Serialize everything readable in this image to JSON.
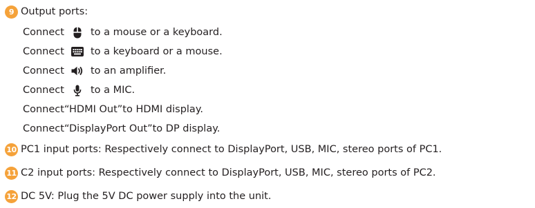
{
  "accent_color": "#f5a23a",
  "section9": {
    "badge": "9",
    "title": "Output ports:",
    "lines": [
      {
        "prefix": "Connect",
        "icon": "mouse-icon",
        "suffix": "to a mouse or a keyboard."
      },
      {
        "prefix": "Connect",
        "icon": "keyboard-icon",
        "suffix": "to a keyboard or a mouse."
      },
      {
        "prefix": "Connect",
        "icon": "speaker-icon",
        "suffix": "to an amplifier."
      },
      {
        "prefix": "Connect",
        "icon": "microphone-icon",
        "suffix": "to a MIC."
      }
    ],
    "hdmi_line": "Connect“HDMI Out”to HDMI display.",
    "dp_line": "Connect“DisplayPort Out”to DP display."
  },
  "items": [
    {
      "badge": "10",
      "text": "PC1 input ports: Respectively connect to DisplayPort, USB, MIC, stereo ports of PC1."
    },
    {
      "badge": "11",
      "text": "C2 input ports: Respectively connect to DisplayPort, USB, MIC, stereo ports of PC2."
    },
    {
      "badge": "12",
      "text": "DC 5V: Plug the 5V DC power supply into the unit."
    }
  ]
}
